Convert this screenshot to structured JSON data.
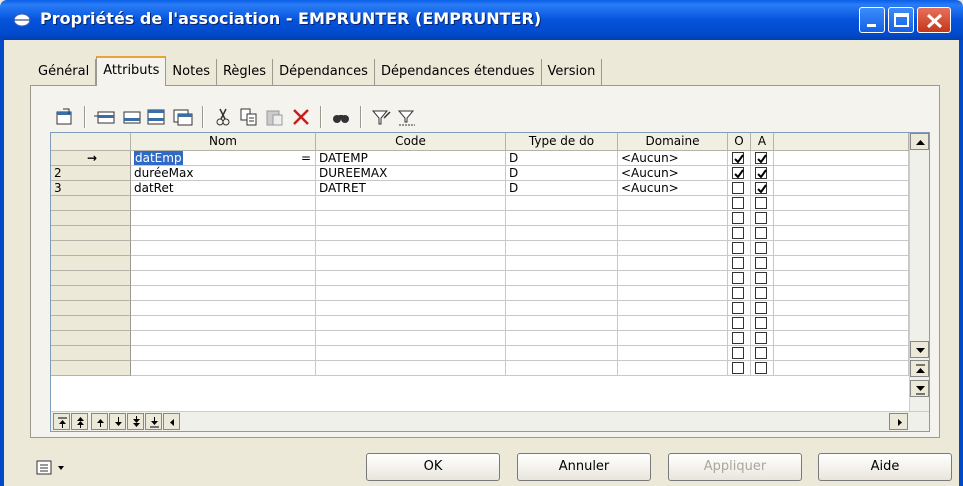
{
  "window": {
    "title": "Propriétés de l'association - EMPRUNTER (EMPRUNTER)"
  },
  "tabs": [
    {
      "label": "Général"
    },
    {
      "label": "Attributs"
    },
    {
      "label": "Notes"
    },
    {
      "label": "Règles"
    },
    {
      "label": "Dépendances"
    },
    {
      "label": "Dépendances étendues"
    },
    {
      "label": "Version"
    }
  ],
  "active_tab": "Attributs",
  "toolbar": {
    "icons": [
      "properties-icon",
      "insert-row-icon",
      "add-row-icon",
      "add-rows-icon",
      "copy-rows-icon",
      "cut-icon",
      "copy-icon",
      "paste-icon",
      "delete-icon",
      "find-icon",
      "filter-icon",
      "filter-clear-icon"
    ]
  },
  "grid": {
    "columns": [
      "Nom",
      "Code",
      "Type de do",
      "Domaine",
      "O",
      "A"
    ],
    "rows": [
      {
        "marker": "→",
        "nom": "datEmp",
        "equals": "=",
        "code": "DATEMP",
        "type": "D",
        "domaine": "<Aucun>",
        "o": true,
        "a": true
      },
      {
        "marker": "2",
        "nom": "duréeMax",
        "equals": "",
        "code": "DUREEMAX",
        "type": "D",
        "domaine": "<Aucun>",
        "o": true,
        "a": true
      },
      {
        "marker": "3",
        "nom": "datRet",
        "equals": "",
        "code": "DATRET",
        "type": "D",
        "domaine": "<Aucun>",
        "o": false,
        "a": true
      }
    ],
    "empty_rows": 12
  },
  "buttons": {
    "ok": "OK",
    "cancel": "Annuler",
    "apply": "Appliquer",
    "help": "Aide"
  }
}
